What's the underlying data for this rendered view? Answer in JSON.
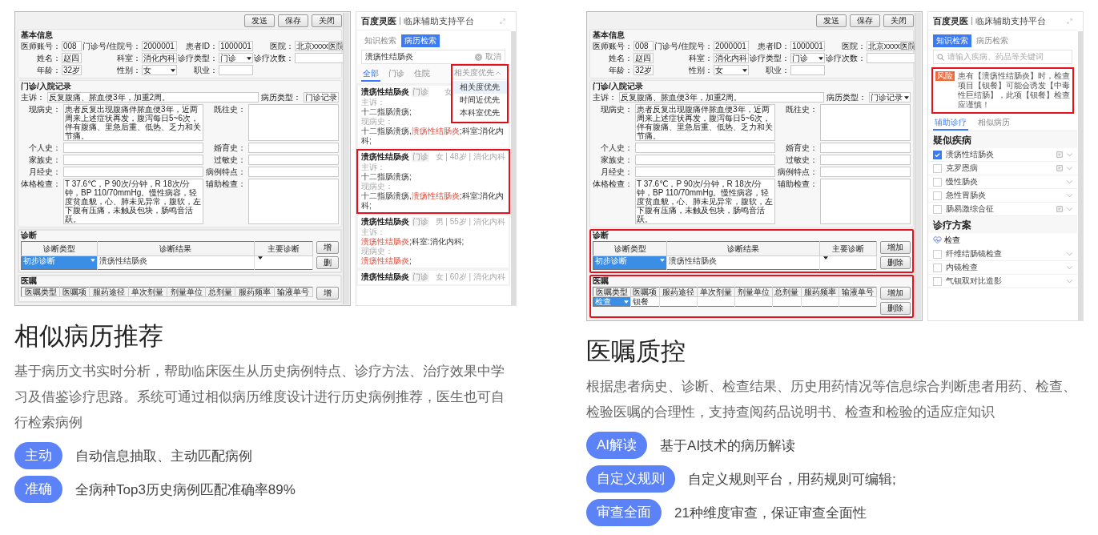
{
  "cards": [
    {
      "screenshot": {
        "form": {
          "buttons": [
            "发送",
            "保存",
            "关闭"
          ],
          "basic": {
            "title": "基本信息",
            "fields": [
              {
                "label": "医师账号：",
                "value": "008",
                "kind": "input"
              },
              {
                "label": "门诊号/住院号：",
                "value": "2000001",
                "kind": "input"
              },
              {
                "label": "患者ID：",
                "value": "1000001",
                "kind": "input"
              },
              {
                "label": "医院：",
                "value": "北京xxxx医院",
                "kind": "input"
              },
              {
                "label": "姓名：",
                "value": "赵四",
                "kind": "input"
              },
              {
                "label": "科室：",
                "value": "消化内科",
                "kind": "input"
              },
              {
                "label": "诊疗类型：",
                "value": "门诊",
                "kind": "select"
              },
              {
                "label": "诊疗次数：",
                "kind": "input"
              },
              {
                "label": "年龄：",
                "value": "32岁",
                "kind": "input"
              },
              {
                "label": "性别：",
                "value": "女",
                "kind": "select"
              },
              {
                "label": "职业：",
                "kind": "input"
              }
            ]
          },
          "record": {
            "title": "门诊/入院记录",
            "chief": {
              "label": "主诉：",
              "value": "反复腹痛、脓血便3年，加重2周。"
            },
            "record_type": {
              "label": "病历类型：",
              "value": "门诊记录",
              "kind": "input"
            },
            "fields": [
              {
                "label": "现病史：",
                "value": "患者反复出现腹痛伴脓血便3年，近两周来上述症状再发，腹泻每日5~6次，伴有腹痛、里急后重、低热、乏力和关节痛。"
              },
              {
                "label": "既往史："
              },
              {
                "label": "个人史："
              },
              {
                "label": "婚育史："
              },
              {
                "label": "家族史："
              },
              {
                "label": "过敏史："
              },
              {
                "label": "月经史："
              },
              {
                "label": "病例特点："
              },
              {
                "label": "体格检查：",
                "value": "T 37.6℃，P 90次/分钟，R 18次/分钟，BP 110/70mmHg。慢性病容，轻度贫血貌，心、肺未见异常，腹软，左下腹有压痛，未触及包块，肠鸣音活跃。"
              },
              {
                "label": "辅助检查："
              }
            ]
          },
          "diagnosis": {
            "title": "诊断",
            "highlighted": false,
            "columns": [
              "诊断类型",
              "诊断结果",
              "主要诊断"
            ],
            "rows": [
              {
                "cells": [
                  {
                    "kind": "select",
                    "value": "初步诊断",
                    "selected": true
                  },
                  {
                    "kind": "text",
                    "value": "溃疡性结肠炎",
                    "selected": false
                  },
                  {
                    "kind": "select",
                    "selected": false
                  }
                ]
              }
            ],
            "buttons": [
              "增",
              "删"
            ]
          },
          "orders": {
            "title": "医嘱",
            "highlighted": false,
            "columns": [
              "医嘱类型",
              "医嘱项",
              "服药途径",
              "单次剂量",
              "剂量单位",
              "总剂量",
              "服药频率",
              "输液单号"
            ],
            "buttons": [
              "增"
            ]
          }
        },
        "panel": {
          "kind": "case_search",
          "brand": "百度灵医",
          "subtitle": "临床辅助支持平台",
          "tabs": [
            {
              "label": "知识检索",
              "selected": false
            },
            {
              "label": "病历检索",
              "selected": true
            }
          ],
          "search": {
            "value": "溃疡性结肠炎",
            "action": "取消"
          },
          "filters": [
            {
              "label": "全部",
              "selected": true
            },
            {
              "label": "门诊",
              "selected": false
            },
            {
              "label": "住院",
              "selected": false
            }
          ],
          "sort": {
            "label": "相关度优先",
            "expanded": true,
            "options": [
              {
                "label": "相关度优先",
                "selected": true
              },
              {
                "label": "时间近优先",
                "selected": false
              },
              {
                "label": "本科室优先",
                "selected": false
              }
            ]
          },
          "results": [
            {
              "title": "溃疡性结肠炎",
              "tag": "门诊",
              "meta": "女",
              "highlighted": false,
              "fields": [
                {
                  "label": "主诉：",
                  "parts": [
                    {
                      "text": "十二指肠溃疡;",
                      "match": false
                    }
                  ]
                },
                {
                  "label": "现病史：",
                  "parts": [
                    {
                      "text": "十二指肠溃疡,",
                      "match": false
                    },
                    {
                      "text": "溃疡性结肠炎",
                      "match": true
                    },
                    {
                      "text": ";科室:消化内科;",
                      "match": false
                    }
                  ]
                }
              ]
            },
            {
              "title": "溃疡性结肠炎",
              "tag": "门诊",
              "meta": "女 | 48岁 | 消化内科",
              "highlighted": true,
              "fields": [
                {
                  "label": "主诉：",
                  "parts": [
                    {
                      "text": "十二指肠溃疡;",
                      "match": false
                    }
                  ]
                },
                {
                  "label": "现病史：",
                  "parts": [
                    {
                      "text": "十二指肠溃疡,",
                      "match": false
                    },
                    {
                      "text": "溃疡性结肠炎",
                      "match": true
                    },
                    {
                      "text": ";科室:消化内科;",
                      "match": false
                    }
                  ]
                }
              ]
            },
            {
              "title": "溃疡性结肠炎",
              "tag": "门诊",
              "meta": "男 | 55岁 | 消化内科",
              "highlighted": false,
              "fields": [
                {
                  "label": "主诉：",
                  "parts": [
                    {
                      "text": "溃疡性结肠炎",
                      "match": true
                    },
                    {
                      "text": ";科室:消化内科;",
                      "match": false
                    }
                  ]
                },
                {
                  "label": "现病史：",
                  "parts": [
                    {
                      "text": "溃疡性结肠炎",
                      "match": true
                    },
                    {
                      "text": ";",
                      "match": false
                    }
                  ]
                }
              ]
            },
            {
              "title": "溃疡性结肠炎",
              "tag": "门诊",
              "meta": "女 | 60岁 | 消化内科",
              "highlighted": false
            }
          ]
        }
      },
      "title": "相似病历推荐",
      "description": "基于病历文书实时分析，帮助临床医生从历史病例特点、诊疗方法、治疗效果中学习及借鉴诊疗思路。系统可通过相似病历维度设计进行历史病例推荐，医生也可自行检索病例",
      "features": [
        {
          "badge": "主动",
          "text": "自动信息抽取、主动匹配病例"
        },
        {
          "badge": "准确",
          "text": "全病种Top3历史病例匹配准确率89%"
        }
      ]
    },
    {
      "screenshot": {
        "form": {
          "buttons": [
            "发送",
            "保存",
            "关闭"
          ],
          "basic": {
            "title": "基本信息",
            "fields": [
              {
                "label": "医师账号：",
                "value": "008",
                "kind": "input"
              },
              {
                "label": "门诊号/住院号：",
                "value": "2000001",
                "kind": "input"
              },
              {
                "label": "患者ID：",
                "value": "1000001",
                "kind": "input"
              },
              {
                "label": "医院：",
                "value": "北京xxxx医院",
                "kind": "input"
              },
              {
                "label": "姓名：",
                "value": "赵四",
                "kind": "input"
              },
              {
                "label": "科室：",
                "value": "消化内科",
                "kind": "input"
              },
              {
                "label": "诊疗类型：",
                "value": "门诊",
                "kind": "select"
              },
              {
                "label": "诊疗次数：",
                "kind": "input"
              },
              {
                "label": "年龄：",
                "value": "32岁",
                "kind": "input"
              },
              {
                "label": "性别：",
                "value": "女",
                "kind": "select"
              },
              {
                "label": "职业：",
                "kind": "input"
              }
            ]
          },
          "record": {
            "title": "门诊/入院记录",
            "chief": {
              "label": "主诉：",
              "value": "反复腹痛、脓血便3年，加重2周。"
            },
            "record_type": {
              "label": "病历类型：",
              "value": "门诊记录",
              "kind": "select"
            },
            "fields": [
              {
                "label": "现病史：",
                "value": "患者反复出现腹痛伴脓血便3年，近两周来上述症状再发，腹泻每日5~6次，伴有腹痛、里急后重、低热、乏力和关节痛。"
              },
              {
                "label": "既往史："
              },
              {
                "label": "个人史："
              },
              {
                "label": "婚育史："
              },
              {
                "label": "家族史："
              },
              {
                "label": "过敏史："
              },
              {
                "label": "月经史："
              },
              {
                "label": "病例特点："
              },
              {
                "label": "体格检查：",
                "value": "T 37.6℃，P 90次/分钟，R 18次/分钟，BP 110/70mmHg。慢性病容，轻度贫血貌，心、肺未见异常，腹软，左下腹有压痛，未触及包块，肠鸣音活跃。"
              },
              {
                "label": "辅助检查："
              }
            ]
          },
          "diagnosis": {
            "title": "诊断",
            "highlighted": true,
            "columns": [
              "诊断类型",
              "诊断结果",
              "主要诊断"
            ],
            "rows": [
              {
                "cells": [
                  {
                    "kind": "select",
                    "value": "初步诊断",
                    "selected": true
                  },
                  {
                    "kind": "text",
                    "value": "溃疡性结肠炎",
                    "selected": false
                  },
                  {
                    "kind": "select",
                    "selected": false
                  }
                ]
              }
            ],
            "buttons": [
              "增加",
              "删除"
            ]
          },
          "orders": {
            "title": "医嘱",
            "highlighted": true,
            "columns": [
              "医嘱类型",
              "医嘱项",
              "服药途径",
              "单次剂量",
              "剂量单位",
              "总剂量",
              "服药频率",
              "输液单号"
            ],
            "rows": [
              {
                "cells": [
                  {
                    "kind": "select",
                    "value": "检查",
                    "selected": true
                  },
                  {
                    "kind": "text",
                    "value": "钡餐",
                    "selected": false
                  },
                  {
                    "kind": "text",
                    "selected": false
                  },
                  {
                    "kind": "text",
                    "selected": false
                  },
                  {
                    "kind": "text",
                    "selected": false
                  },
                  {
                    "kind": "text",
                    "selected": false
                  },
                  {
                    "kind": "text",
                    "selected": false
                  },
                  {
                    "kind": "text",
                    "selected": false
                  }
                ]
              }
            ],
            "buttons": [
              "增加",
              "删除"
            ]
          }
        },
        "panel": {
          "kind": "assist",
          "brand": "百度灵医",
          "subtitle": "临床辅助支持平台",
          "tabs": [
            {
              "label": "知识检索",
              "selected": true
            },
            {
              "label": "病历检索",
              "selected": false
            }
          ],
          "search": {
            "placeholder": "请输入疾病、药品等关键词"
          },
          "alert": {
            "badge": "风险",
            "text": "患有【溃疡性结肠炎】时，检查项目【钡餐】可能会诱发【中毒性巨结肠】，此项【钡餐】检查应谨慎！",
            "highlighted": true
          },
          "subtabs": [
            {
              "label": "辅助诊疗",
              "selected": true
            },
            {
              "label": "相似病历",
              "selected": false
            }
          ],
          "sections": [
            {
              "title": "疑似疾病",
              "items": [
                {
                  "label": "溃疡性结肠炎",
                  "checked": true,
                  "doc": true
                },
                {
                  "label": "克罗恩病",
                  "checked": false,
                  "doc": true
                },
                {
                  "label": "慢性肠炎",
                  "checked": false,
                  "doc": false
                },
                {
                  "label": "急性胃肠炎",
                  "checked": false,
                  "doc": false
                },
                {
                  "label": "肠易激综合征",
                  "checked": false,
                  "doc": true
                }
              ]
            },
            {
              "title": "诊疗方案",
              "subtitle": "检查",
              "items": [
                {
                  "label": "纤维结肠镜检查",
                  "checked": false,
                  "doc": false
                },
                {
                  "label": "内镜检查",
                  "checked": false,
                  "doc": false
                },
                {
                  "label": "气钡双对比造影",
                  "checked": false,
                  "doc": false
                }
              ]
            }
          ]
        }
      },
      "title": "医嘱质控",
      "description": "根据患者病史、诊断、检查结果、历史用药情况等信息综合判断患者用药、检查、检验医嘱的合理性，支持查阅药品说明书、检查和检验的适应症知识",
      "features": [
        {
          "badge": "AI解读",
          "text": "基于AI技术的病历解读"
        },
        {
          "badge": "自定义规则",
          "text": "自定义规则平台，用药规则可编辑;"
        },
        {
          "badge": "审查全面",
          "text": "21种维度审查，保证审查全面性"
        }
      ]
    }
  ]
}
